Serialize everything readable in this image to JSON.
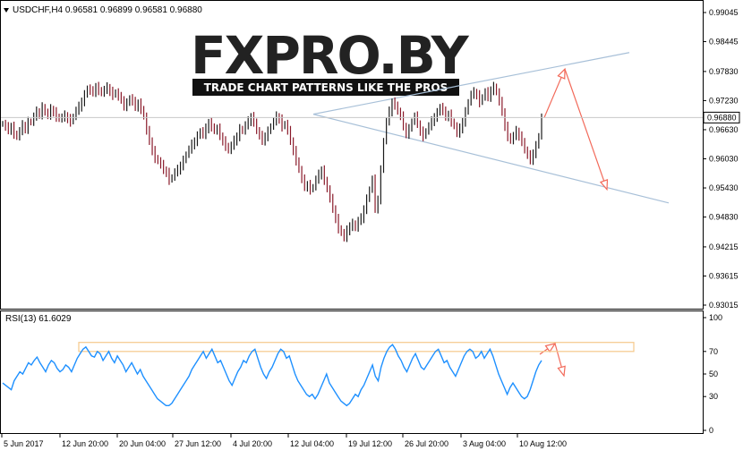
{
  "chart_data": [
    {
      "type": "candlestick",
      "symbol": "USDCHF,H4",
      "header": "USDCHF,H4  0.96581 0.96899 0.96581 0.96880",
      "ohlc_last": {
        "open": 0.96581,
        "high": 0.96899,
        "low": 0.96581,
        "close": 0.9688
      },
      "current_price_label": "0.96880",
      "y_ticks": [
        "0.99045",
        "0.98445",
        "0.97830",
        "0.97230",
        "0.96630",
        "0.96030",
        "0.95430",
        "0.94830",
        "0.94215",
        "0.93615",
        "0.93015"
      ],
      "ylim": [
        0.93015,
        0.99045
      ],
      "x_ticks": [
        "5 Jun 2017",
        "12 Jun 20:00",
        "20 Jun 04:00",
        "27 Jun 12:00",
        "4 Jul 20:00",
        "12 Jul 04:00",
        "19 Jul 12:00",
        "26 Jul 20:00",
        "3 Aug 04:00",
        "10 Aug 12:00"
      ],
      "series": [
        {
          "values": [
            0.9675,
            0.9668,
            0.9662,
            0.967,
            0.9655,
            0.9648,
            0.966,
            0.9672,
            0.9665,
            0.968,
            0.9678,
            0.969,
            0.97,
            0.9695,
            0.971,
            0.9698,
            0.9692,
            0.9705,
            0.97,
            0.969,
            0.9685,
            0.9688,
            0.9692,
            0.9686,
            0.968,
            0.969,
            0.9702,
            0.971,
            0.9722,
            0.9735,
            0.9748,
            0.9742,
            0.974,
            0.9752,
            0.9745,
            0.9738,
            0.9745,
            0.975,
            0.9742,
            0.9735,
            0.974,
            0.973,
            0.9725,
            0.9712,
            0.9718,
            0.9728,
            0.972,
            0.971,
            0.9718,
            0.9706,
            0.969,
            0.966,
            0.964,
            0.962,
            0.9605,
            0.9598,
            0.959,
            0.958,
            0.9575,
            0.956,
            0.9565,
            0.9575,
            0.958,
            0.959,
            0.96,
            0.9612,
            0.9622,
            0.9632,
            0.964,
            0.965,
            0.966,
            0.9652,
            0.9665,
            0.9678,
            0.967,
            0.966,
            0.9665,
            0.965,
            0.964,
            0.963,
            0.962,
            0.963,
            0.964,
            0.965,
            0.9665,
            0.966,
            0.9672,
            0.968,
            0.969,
            0.968,
            0.966,
            0.965,
            0.964,
            0.965,
            0.966,
            0.967,
            0.968,
            0.969,
            0.9685,
            0.967,
            0.9675,
            0.966,
            0.964,
            0.962,
            0.96,
            0.958,
            0.956,
            0.9545,
            0.955,
            0.954,
            0.9545,
            0.956,
            0.957,
            0.958,
            0.956,
            0.954,
            0.952,
            0.95,
            0.948,
            0.946,
            0.945,
            0.944,
            0.9455,
            0.9465,
            0.947,
            0.946,
            0.9475,
            0.948,
            0.95,
            0.952,
            0.954,
            0.956,
            0.95,
            0.952,
            0.958,
            0.964,
            0.968,
            0.97,
            0.972,
            0.9715,
            0.97,
            0.969,
            0.967,
            0.9655,
            0.9665,
            0.968,
            0.969,
            0.9675,
            0.966,
            0.965,
            0.966,
            0.967,
            0.968,
            0.969,
            0.9698,
            0.971,
            0.97,
            0.969,
            0.9695,
            0.968,
            0.967,
            0.9655,
            0.9665,
            0.968,
            0.97,
            0.972,
            0.9735,
            0.974,
            0.9735,
            0.972,
            0.973,
            0.974,
            0.973,
            0.9745,
            0.9752,
            0.974,
            0.972,
            0.97,
            0.967,
            0.965,
            0.964,
            0.965,
            0.966,
            0.965,
            0.964,
            0.962,
            0.961,
            0.96,
            0.9615,
            0.963,
            0.965,
            0.9688
          ]
        }
      ],
      "projection_arrows": [
        {
          "from": [
            0.9688,
            0.9688
          ],
          "to": [
            0.9788,
            0.9788
          ]
        },
        {
          "from": [
            0.9788,
            0.9788
          ],
          "to": [
            0.954,
            0.954
          ]
        }
      ],
      "trendlines": "triangle pattern formed by upper and lower converging-diverging lines"
    },
    {
      "type": "line",
      "label": "RSI(13) 61.6029",
      "y_ticks": [
        "100",
        "70",
        "50",
        "30",
        "0"
      ],
      "ylim": [
        0,
        100
      ],
      "zone": [
        70,
        78
      ],
      "series": [
        {
          "values": [
            42,
            40,
            38,
            36,
            44,
            48,
            52,
            50,
            55,
            60,
            58,
            62,
            65,
            60,
            56,
            52,
            58,
            62,
            60,
            55,
            52,
            54,
            58,
            56,
            52,
            58,
            64,
            68,
            72,
            74,
            70,
            66,
            65,
            70,
            68,
            62,
            66,
            70,
            64,
            60,
            66,
            62,
            58,
            52,
            56,
            60,
            55,
            50,
            54,
            48,
            44,
            40,
            36,
            32,
            28,
            26,
            24,
            22,
            22,
            24,
            28,
            32,
            36,
            40,
            44,
            48,
            54,
            58,
            62,
            66,
            70,
            64,
            68,
            72,
            66,
            60,
            62,
            56,
            50,
            44,
            40,
            46,
            52,
            56,
            62,
            60,
            66,
            70,
            72,
            64,
            56,
            50,
            46,
            52,
            56,
            62,
            68,
            72,
            70,
            64,
            66,
            58,
            50,
            44,
            40,
            36,
            32,
            30,
            32,
            28,
            32,
            38,
            44,
            50,
            42,
            38,
            34,
            30,
            26,
            24,
            22,
            24,
            28,
            32,
            30,
            36,
            40,
            46,
            52,
            58,
            48,
            44,
            56,
            64,
            70,
            74,
            76,
            72,
            66,
            62,
            56,
            52,
            58,
            64,
            68,
            62,
            56,
            54,
            58,
            62,
            66,
            70,
            72,
            66,
            60,
            62,
            56,
            52,
            48,
            54,
            60,
            66,
            70,
            72,
            70,
            64,
            66,
            70,
            64,
            68,
            72,
            66,
            58,
            50,
            44,
            38,
            32,
            38,
            42,
            38,
            34,
            30,
            28,
            30,
            36,
            44,
            52,
            58,
            62
          ]
        }
      ]
    }
  ],
  "watermark": {
    "brand": "FXPRO.BY",
    "tagline": "TRADE CHART PATTERNS LIKE THE PROS"
  },
  "colors": {
    "bull": "#1a1a1a",
    "bear": "#8a1a2a",
    "rsi": "#1e90ff",
    "trend": "#a8c0d8",
    "arrow": "#f26a5a",
    "zone": "#f5c88a"
  }
}
